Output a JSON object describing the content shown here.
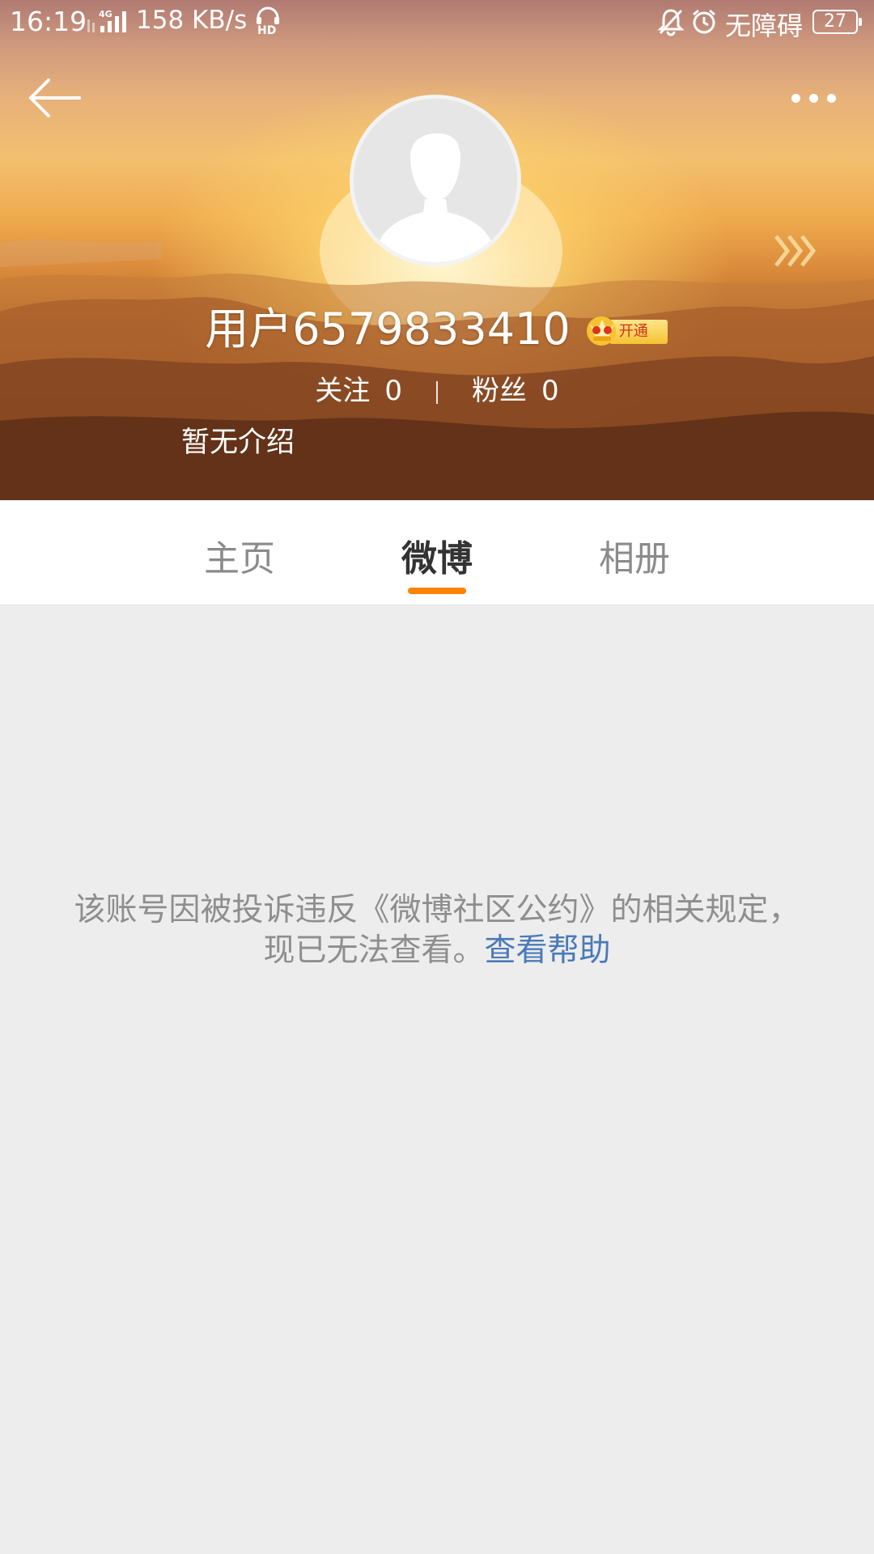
{
  "status_bar": {
    "time": "16:19",
    "network": "4G",
    "speed": "158 KB/s",
    "accessibility": "无障碍",
    "battery": "27"
  },
  "nav": {
    "back_icon": "arrow-left-icon",
    "more_icon": "more-dots-icon"
  },
  "profile": {
    "username": "用户6579833410",
    "vip_label": "开通",
    "following_label": "关注",
    "following_count": "0",
    "followers_label": "粉丝",
    "followers_count": "0",
    "bio": "暂无介绍"
  },
  "tabs": [
    {
      "label": "主页",
      "active": false
    },
    {
      "label": "微博",
      "active": true
    },
    {
      "label": "相册",
      "active": false
    }
  ],
  "notice": {
    "message": "该账号因被投诉违反《微博社区公约》的相关规定，现已无法查看。",
    "help_link": "查看帮助"
  },
  "colors": {
    "accent": "#ff8200",
    "link": "#4b7ab8",
    "background": "#ededed"
  }
}
